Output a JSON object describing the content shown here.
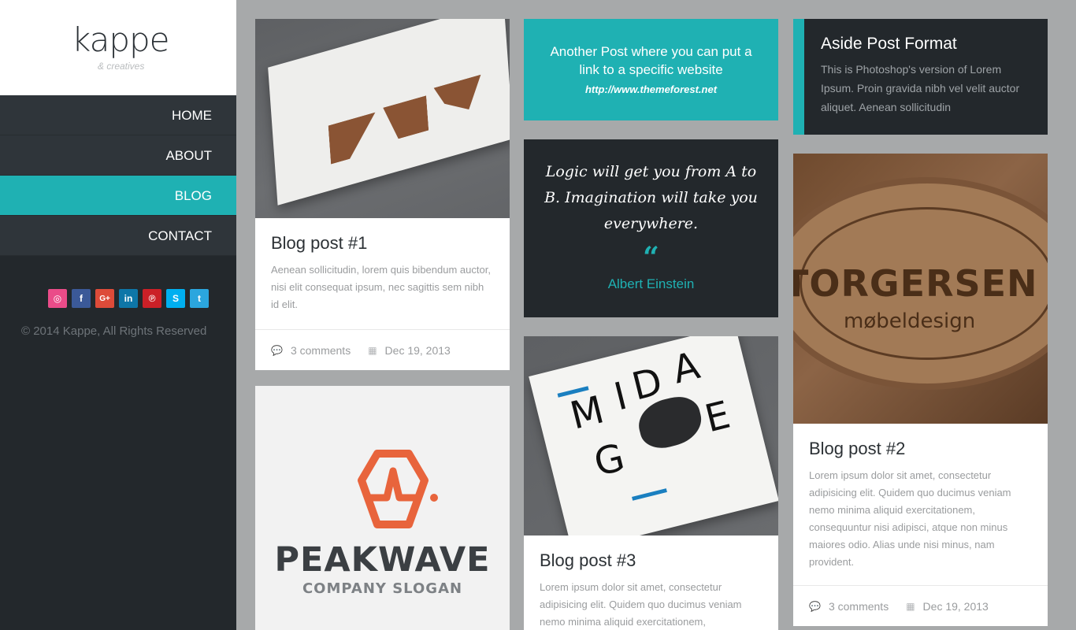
{
  "brand": {
    "name": "kappe",
    "tagline": "& creatives"
  },
  "nav": {
    "items": [
      {
        "label": "HOME"
      },
      {
        "label": "ABOUT"
      },
      {
        "label": "BLOG"
      },
      {
        "label": "CONTACT"
      }
    ],
    "active": "BLOG"
  },
  "social": [
    {
      "icon": "dribbble-icon",
      "glyph": "◎",
      "color": "#ea4c89"
    },
    {
      "icon": "facebook-icon",
      "glyph": "f",
      "color": "#3b5998"
    },
    {
      "icon": "google-plus-icon",
      "glyph": "G+",
      "color": "#dd4b39"
    },
    {
      "icon": "linkedin-icon",
      "glyph": "in",
      "color": "#0e76a8"
    },
    {
      "icon": "pinterest-icon",
      "glyph": "℗",
      "color": "#cb2027"
    },
    {
      "icon": "skype-icon",
      "glyph": "S",
      "color": "#00aff0"
    },
    {
      "icon": "twitter-icon",
      "glyph": "t",
      "color": "#2ba6de"
    }
  ],
  "copyright": "© 2014 Kappe, All Rights Reserved",
  "posts": {
    "post1": {
      "title": "Blog post #1",
      "excerpt": "Aenean sollicitudin, lorem quis bibendum auctor, nisi elit consequat ipsum, nec sagittis sem nibh id elit.",
      "comments": "3 comments",
      "date": "Dec 19, 2013"
    },
    "link_post": {
      "text": "Another Post where you can put a link to a specific website",
      "url": "http://www.themeforest.net"
    },
    "quote_post": {
      "quote": "Logic will get you from A to B. Imagination will take you everywhere.",
      "mark": "“",
      "author": "Albert Einstein"
    },
    "aside_post": {
      "title": "Aside Post Format",
      "text": "This is Photoshop's version of Lorem Ipsum. Proin gravida nibh vel velit auctor aliquet. Aenean sollicitudin"
    },
    "post2": {
      "image_text": "TORGERSEN",
      "image_subtext": "møbeldesign",
      "title": "Blog post #2",
      "excerpt": "Lorem ipsum dolor sit amet, consectetur adipisicing elit. Quidem quo ducimus veniam nemo minima aliquid exercitationem, consequuntur nisi adipisci, atque non minus maiores odio. Alias unde nisi minus, nam provident.",
      "comments": "3 comments",
      "date": "Dec 19, 2013"
    },
    "post3": {
      "title": "Blog post #3",
      "excerpt": "Lorem ipsum dolor sit amet, consectetur adipisicing elit. Quidem quo ducimus veniam nemo minima aliquid exercitationem,"
    },
    "peakwave": {
      "name": "PEAKWAVE",
      "slogan": "COMPANY SLOGAN"
    }
  },
  "colors": {
    "accent": "#1fb1b3",
    "dark": "#23282c",
    "background": "#a7a9aa"
  }
}
